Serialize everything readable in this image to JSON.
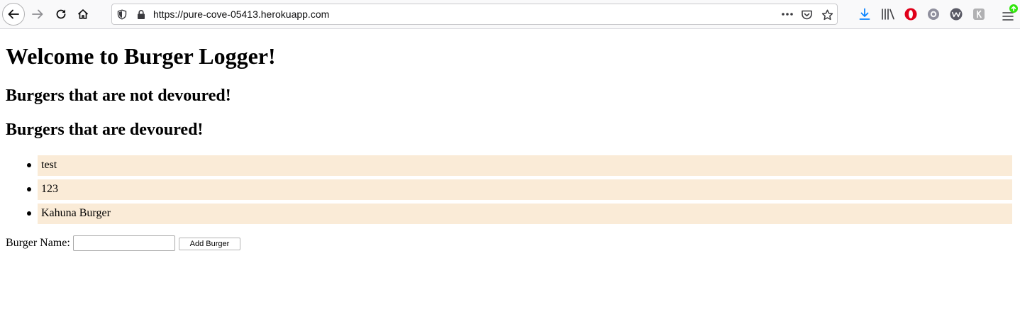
{
  "browser": {
    "url": "https://pure-cove-05413.herokuapp.com",
    "icons": [
      "back-icon",
      "forward-icon",
      "reload-icon",
      "home-icon",
      "shield-icon",
      "lock-icon",
      "more-icon",
      "pocket-icon",
      "bookmark-star-icon",
      "download-icon",
      "library-icon",
      "opera-icon",
      "extension-gear-icon",
      "extension-w-icon",
      "extension-icon",
      "menu-icon"
    ],
    "accent": "#0a84ff"
  },
  "page": {
    "title": "Welcome to Burger Logger!",
    "not_devoured_heading": "Burgers that are not devoured!",
    "devoured_heading": "Burgers that are devoured!",
    "devoured_burgers": [
      {
        "name": "test"
      },
      {
        "name": "123"
      },
      {
        "name": "Kahuna Burger"
      }
    ],
    "item_background": "#faebd7",
    "form": {
      "label": "Burger Name:",
      "input_value": "",
      "button_label": "Add Burger"
    }
  }
}
